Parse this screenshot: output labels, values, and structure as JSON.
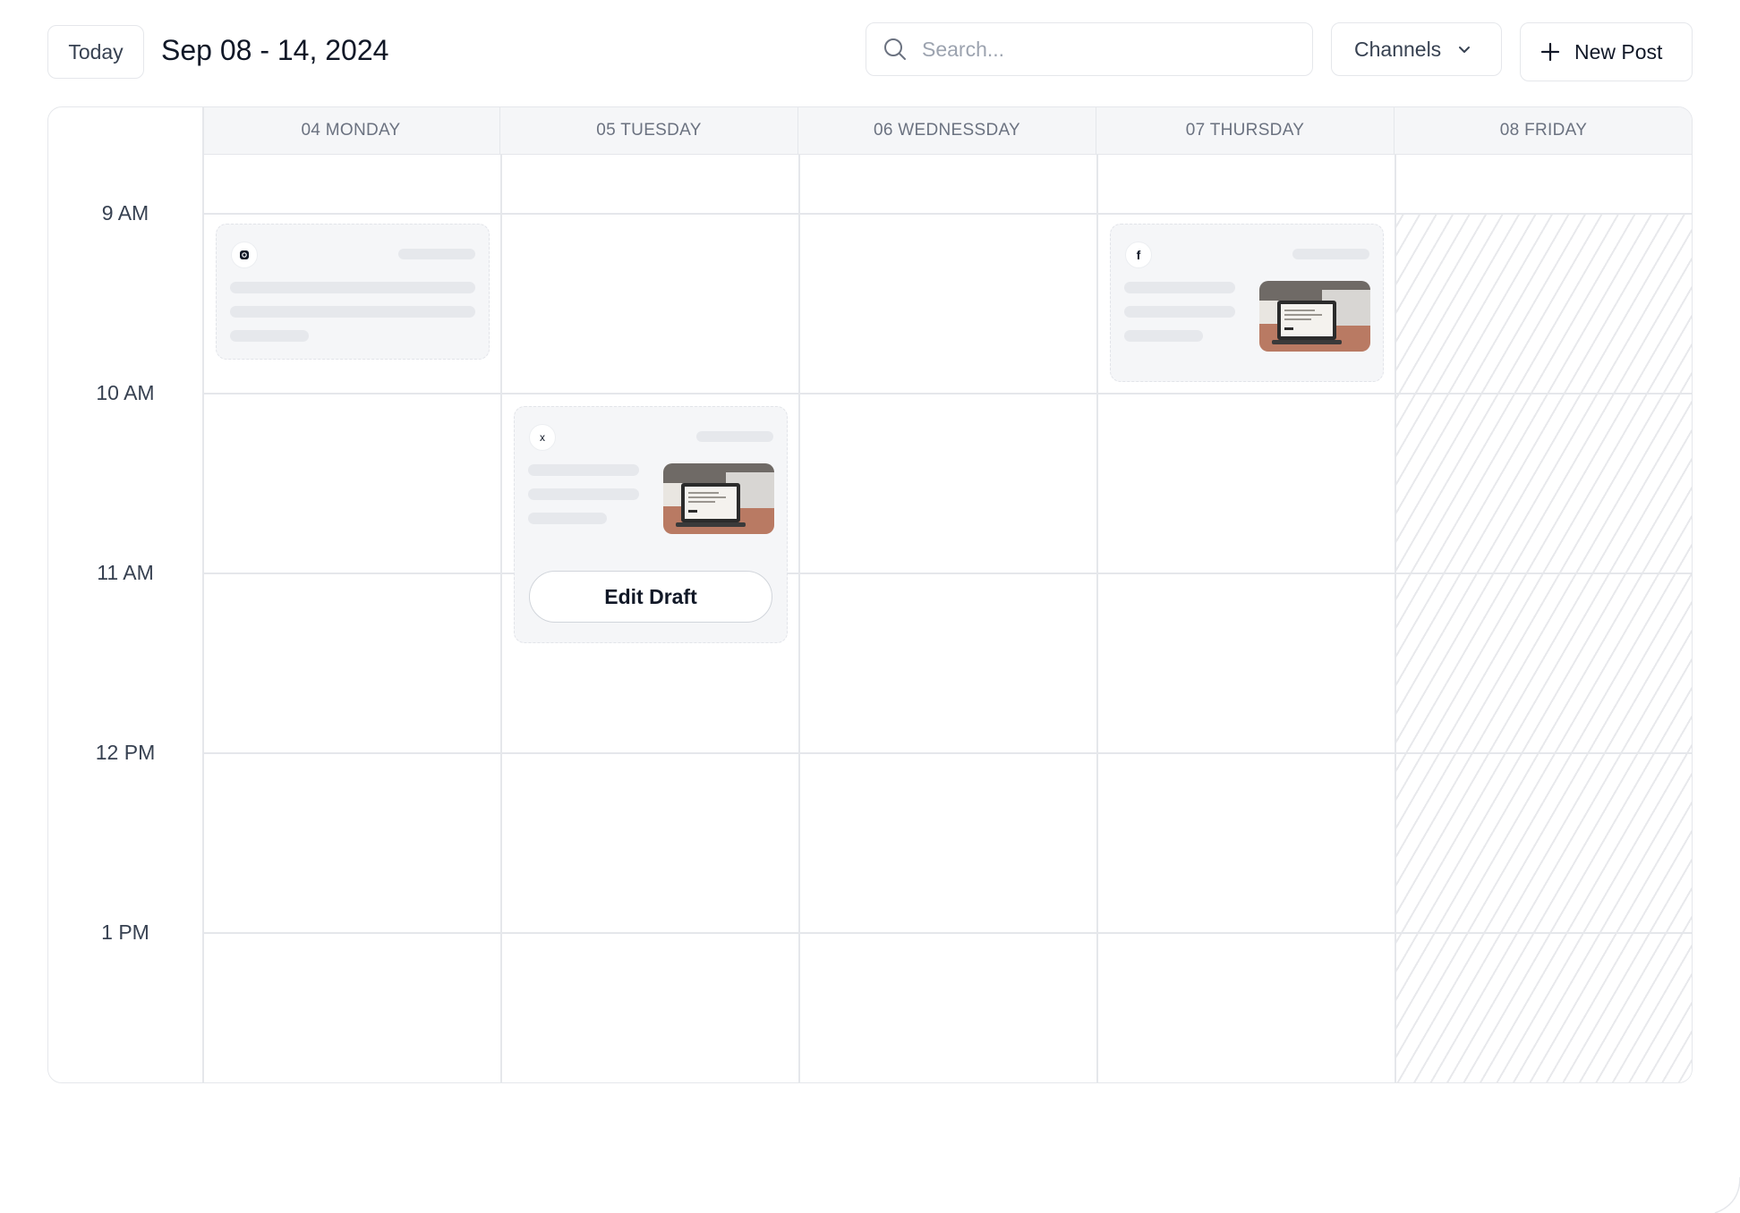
{
  "toolbar": {
    "today_label": "Today",
    "date_range": "Sep 08 - 14, 2024",
    "search_placeholder": "Search...",
    "channels_label": "Channels",
    "new_post_label": "New Post"
  },
  "calendar": {
    "days": [
      {
        "label": "04 MONDAY"
      },
      {
        "label": "05 TUESDAY"
      },
      {
        "label": "06 WEDNESSDAY"
      },
      {
        "label": "07 THURSDAY"
      },
      {
        "label": "08 FRIDAY"
      }
    ],
    "times": [
      "9 AM",
      "10 AM",
      "11 AM",
      "12 PM",
      "1 PM"
    ],
    "posts": [
      {
        "day": "04 MONDAY",
        "channel_icon": "instagram-icon",
        "has_image": false
      },
      {
        "day": "05 TUESDAY",
        "channel_icon": "x-icon",
        "channel_glyph": "x",
        "has_image": true,
        "action_label": "Edit Draft"
      },
      {
        "day": "07 THURSDAY",
        "channel_icon": "facebook-icon",
        "channel_glyph": "f",
        "has_image": true
      }
    ]
  },
  "colors": {
    "header_bg": "#f5f6f8",
    "border": "#e5e7eb",
    "card_bg": "#f5f6f8",
    "skeleton": "#e6e8ec",
    "text_muted": "#6b7280"
  }
}
